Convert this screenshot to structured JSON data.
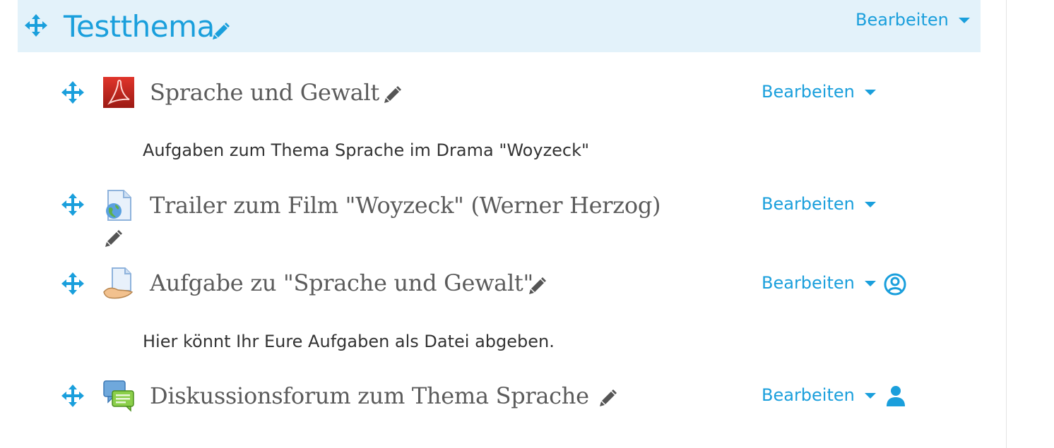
{
  "section": {
    "title": "Testthema",
    "edit_label": "Bearbeiten"
  },
  "activities": [
    {
      "title": "Sprache und Gewalt",
      "icon": "pdf-icon",
      "edit_label": "Bearbeiten",
      "description": "Aufgaben zum Thema Sprache im Drama \"Woyzeck\""
    },
    {
      "title": "Trailer zum Film \"Woyzeck\" (Werner Herzog)",
      "icon": "url-globe-icon",
      "edit_label": "Bearbeiten"
    },
    {
      "title": "Aufgabe zu \"Sprache und Gewalt\"",
      "icon": "assignment-icon",
      "edit_label": "Bearbeiten",
      "description": "Hier könnt Ihr Eure Aufgaben als Datei abgeben.",
      "group_icon": "user-circle-icon"
    },
    {
      "title": "Diskussionsforum zum Thema Sprache",
      "icon": "forum-icon",
      "edit_label": "Bearbeiten",
      "group_icon": "user-icon"
    }
  ],
  "colors": {
    "accent": "#1a9fdc",
    "section_bg": "#e3f2fa",
    "text": "#5b5b5b"
  }
}
